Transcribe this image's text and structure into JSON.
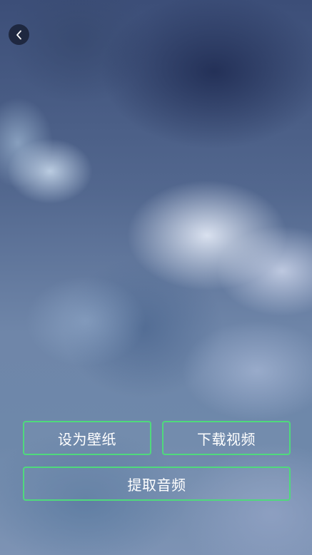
{
  "background": {
    "type": "sky-clouds-photo"
  },
  "nav": {
    "back_icon": "chevron-left-icon"
  },
  "actions": {
    "set_wallpaper_label": "设为壁纸",
    "download_video_label": "下载视频",
    "extract_audio_label": "提取音频"
  },
  "colors": {
    "button_border": "#4fd97c",
    "button_text": "#ffffff",
    "back_button_bg": "#161c30"
  }
}
